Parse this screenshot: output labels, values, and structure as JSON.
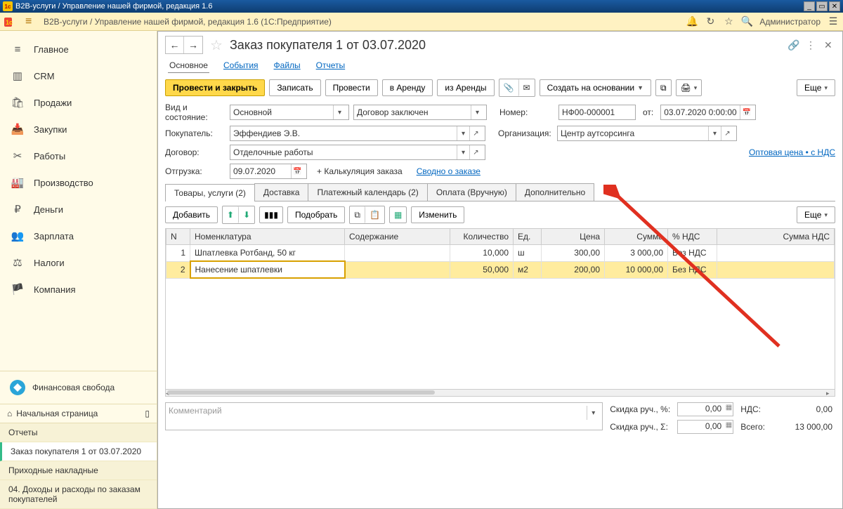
{
  "window": {
    "title": "B2B-услуги / Управление нашей фирмой, редакция 1.6"
  },
  "topbar": {
    "crumb": "B2B-услуги / Управление нашей фирмой, редакция 1.6  (1С:Предприятие)",
    "admin": "Администратор"
  },
  "sidebar": {
    "items": [
      {
        "icon": "≡",
        "label": "Главное"
      },
      {
        "icon": "crm",
        "label": "CRM"
      },
      {
        "icon": "cart",
        "label": "Продажи"
      },
      {
        "icon": "box",
        "label": "Закупки"
      },
      {
        "icon": "tools",
        "label": "Работы"
      },
      {
        "icon": "factory",
        "label": "Производство"
      },
      {
        "icon": "coin",
        "label": "Деньги"
      },
      {
        "icon": "people",
        "label": "Зарплата"
      },
      {
        "icon": "scale",
        "label": "Налоги"
      },
      {
        "icon": "flag",
        "label": "Компания"
      }
    ],
    "finance": "Финансовая свобода",
    "start": "Начальная страница",
    "links": [
      {
        "label": "Отчеты",
        "sel": false
      },
      {
        "label": "Заказ покупателя 1 от 03.07.2020",
        "sel": true
      },
      {
        "label": "Приходные накладные",
        "sel": false
      },
      {
        "label": "04. Доходы и расходы по заказам покупателей",
        "sel": false
      }
    ]
  },
  "doc": {
    "title": "Заказ покупателя 1 от 03.07.2020",
    "top_tabs": [
      "Основное",
      "События",
      "Файлы",
      "Отчеты"
    ],
    "buttons": {
      "post_close": "Провести и закрыть",
      "save": "Записать",
      "post": "Провести",
      "to_rent": "в Аренду",
      "from_rent": "из Аренды",
      "create_based": "Создать на основании",
      "more": "Еще"
    },
    "fields": {
      "kind_lbl": "Вид и состояние:",
      "kind": "Основной",
      "state": "Договор заключен",
      "num_lbl": "Номер:",
      "num": "НФ00-000001",
      "from_lbl": "от:",
      "date": "03.07.2020  0:00:00",
      "buyer_lbl": "Покупатель:",
      "buyer": "Эффендиев Э.В.",
      "org_lbl": "Организация:",
      "org": "Центр аутсорсинга",
      "contract_lbl": "Договор:",
      "contract": "Отделочные работы",
      "price_link": "Оптовая цена • с НДС",
      "ship_lbl": "Отгрузка:",
      "ship": "09.07.2020",
      "calc_link": "+ Калькуляция заказа",
      "summary_link": "Сводно о заказе"
    },
    "dtabs": [
      "Товары, услуги (2)",
      "Доставка",
      "Платежный календарь (2)",
      "Оплата (Вручную)",
      "Дополнительно"
    ],
    "tbl": {
      "add": "Добавить",
      "pick": "Подобрать",
      "edit": "Изменить",
      "cols": [
        "N",
        "Номенклатура",
        "Содержание",
        "Количество",
        "Ед.",
        "Цена",
        "Сумма",
        "% НДС",
        "Сумма НДС"
      ],
      "rows": [
        {
          "n": "1",
          "name": "Шпатлевка Ротбанд, 50 кг",
          "desc": "",
          "qty": "10,000",
          "unit": "ш",
          "price": "300,00",
          "sum": "3 000,00",
          "vat": "Без НДС",
          "vsum": ""
        },
        {
          "n": "2",
          "name": "Нанесение шпатлевки",
          "desc": "",
          "qty": "50,000",
          "unit": "м2",
          "price": "200,00",
          "sum": "10 000,00",
          "vat": "Без НДС",
          "vsum": ""
        }
      ]
    },
    "footer": {
      "comment_ph": "Комментарий",
      "disc_pct_lbl": "Скидка руч., %:",
      "disc_pct": "0,00",
      "disc_sum_lbl": "Скидка руч., Σ:",
      "disc_sum": "0,00",
      "vat_lbl": "НДС:",
      "vat": "0,00",
      "total_lbl": "Всего:",
      "total": "13 000,00"
    }
  }
}
